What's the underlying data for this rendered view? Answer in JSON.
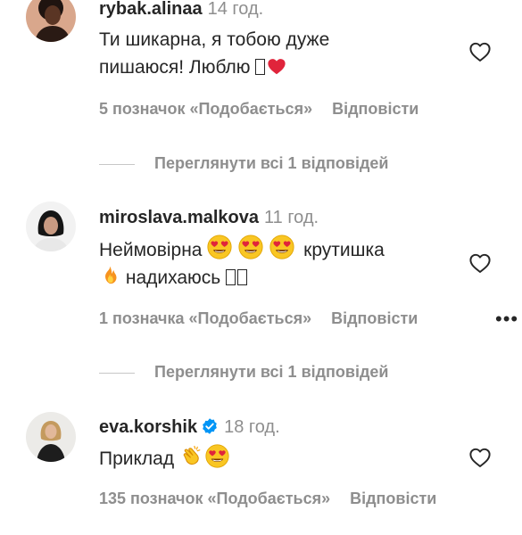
{
  "comments": [
    {
      "username": "rybak.alinaa",
      "time": "14 год.",
      "text_lines": [
        "Ти шикарна, я тобою дуже",
        "пишаюся! Люблю"
      ],
      "likes": "5 позначок «Подобається»",
      "reply": "Відповісти",
      "view_replies": "Переглянути всі 1 відповідей"
    },
    {
      "username": "miroslava.malkova",
      "time": "11 год.",
      "text_lines": [
        "Неймовірна",
        "крутишка",
        "надихаюсь"
      ],
      "likes": "1 позначка «Подобається»",
      "reply": "Відповісти",
      "view_replies": "Переглянути всі 1 відповідей",
      "more": "•••"
    },
    {
      "username": "eva.korshik",
      "verified": true,
      "time": "18 год.",
      "text_lines": [
        "Приклад"
      ],
      "likes": "135 позначок «Подобається»",
      "reply": "Відповісти"
    }
  ],
  "icons": {
    "like": "heart-outline-icon",
    "verified": "verified-badge-icon",
    "emoji_heart": "red-heart-emoji",
    "emoji_love_eyes": "heart-eyes-emoji",
    "emoji_fire": "fire-emoji",
    "emoji_clap": "clapping-hands-emoji",
    "missing_glyph": "missing-glyph-box"
  },
  "colors": {
    "text": "#262626",
    "muted": "#8e8e8e",
    "verified": "#0095f6",
    "heart_red": "#e0243b"
  }
}
